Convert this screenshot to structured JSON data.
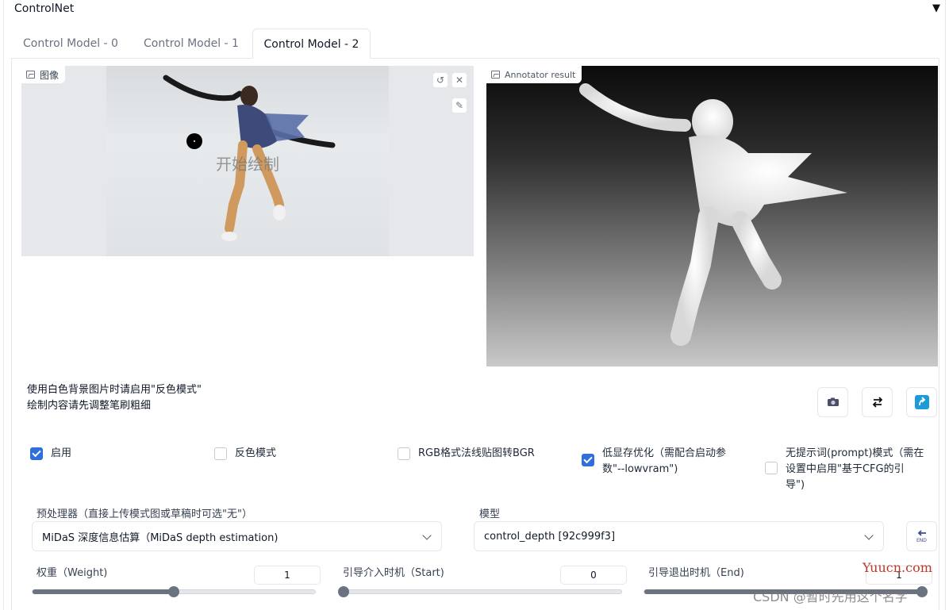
{
  "panel": {
    "title": "ControlNet",
    "collapse_glyph": "▼"
  },
  "tabs": [
    {
      "label": "Control Model - 0"
    },
    {
      "label": "Control Model - 1"
    },
    {
      "label": "Control Model - 2",
      "active": true
    }
  ],
  "input_image": {
    "label": "图像",
    "draw_hint": "开始绘制",
    "icons": [
      "undo-icon",
      "close-icon",
      "brush-icon"
    ]
  },
  "annotator": {
    "label": "Annotator result"
  },
  "hints": {
    "line1": "使用白色背景图片时请启用\"反色模式\"",
    "line2": "绘制内容请先调整笔刷粗细"
  },
  "action_buttons": {
    "camera": "camera-icon",
    "swap": "swap-icon",
    "send": "send-icon"
  },
  "checkboxes": {
    "enable": {
      "label": "启用",
      "checked": true
    },
    "invert": {
      "label": "反色模式",
      "checked": false
    },
    "rgb_bgr": {
      "label": "RGB格式法线贴图转BGR",
      "checked": false
    },
    "lowvram": {
      "label_line1": "低显存优化（需配合启动参",
      "label_line2": "数\"--lowvram\")",
      "checked": true
    },
    "guess_mode": {
      "label_line1": "无提示词(prompt)模式（需在",
      "label_line2": "设置中启用\"基于CFG的引",
      "label_line3": "导\")",
      "checked": false
    }
  },
  "preprocessor": {
    "label": "预处理器（直接上传模式图或草稿时可选\"无\"）",
    "value": "MiDaS 深度信息估算（MiDaS depth estimation)"
  },
  "model": {
    "label": "模型",
    "value": "control_depth [92c999f3]",
    "end_icon": "end-icon"
  },
  "weight": {
    "label": "权重（Weight)",
    "value": "1",
    "fraction": 0.5
  },
  "start": {
    "label": "引导介入时机（Start)",
    "value": "0",
    "fraction": 0.0
  },
  "end": {
    "label": "引导退出时机（End)",
    "value": "1",
    "fraction": 1.0
  },
  "watermarks": {
    "site": "Yuucn.com",
    "author": "CSDN @暂时先用这个名字"
  },
  "colors": {
    "accent": "#2f6fdc",
    "send_button": "#1d9bd8",
    "watermark_red": "#c0392b"
  }
}
